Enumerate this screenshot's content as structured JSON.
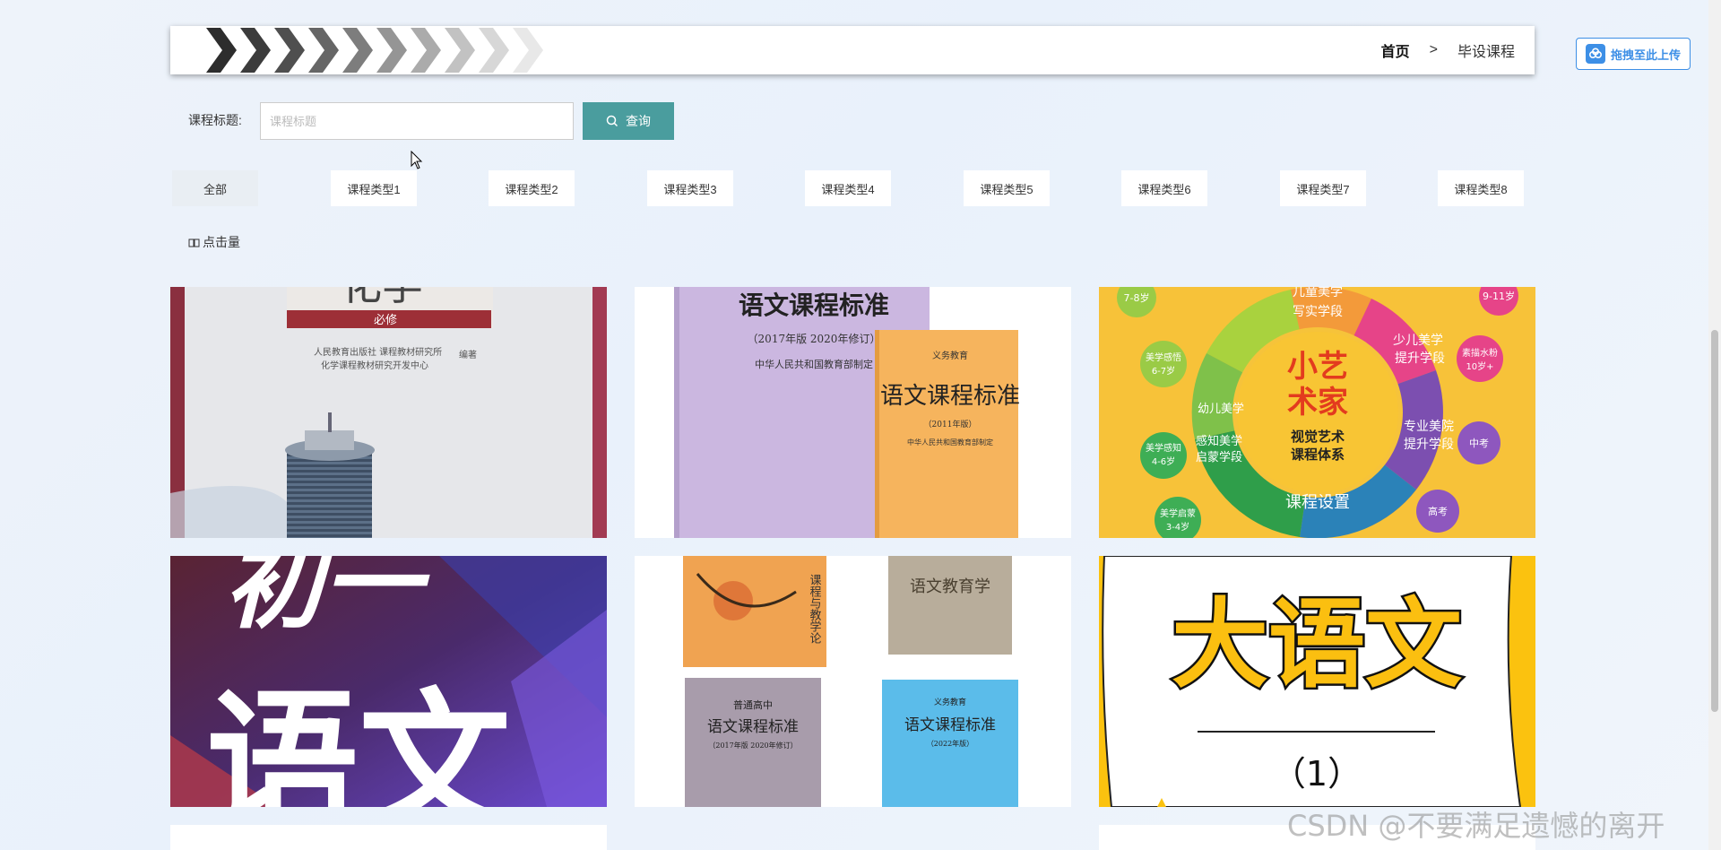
{
  "header": {
    "breadcrumb_home": "首页",
    "breadcrumb_sep": ">",
    "breadcrumb_current": "毕设课程"
  },
  "upload": {
    "label": "拖拽至此上传"
  },
  "search": {
    "label": "课程标题:",
    "placeholder": "课程标题",
    "button_label": "查询"
  },
  "categories": [
    "全部",
    "课程类型1",
    "课程类型2",
    "课程类型3",
    "课程类型4",
    "课程类型5",
    "课程类型6",
    "课程类型7",
    "课程类型8"
  ],
  "sort": {
    "label": "点击量"
  },
  "cards": [
    {
      "texts": [
        "化学",
        "必修",
        "人民教育出版社 课程教材研究所",
        "化学课程教材研究开发中心",
        "编著"
      ]
    },
    {
      "texts": [
        "语文课程标准",
        "（2017年版 2020年修订）",
        "中华人民共和国教育部制定",
        "义务教育",
        "语文课程标准",
        "（2011年版）",
        "中华人民共和国教育部制定"
      ]
    },
    {
      "texts": [
        "小艺",
        "术家",
        "视觉艺术",
        "课程体系",
        "课程设置",
        "儿童美学",
        "写实学段",
        "少儿美学",
        "提升学段",
        "专业美院",
        "提升学段",
        "感知美学",
        "启蒙学段",
        "幼儿美学",
        "7-8岁",
        "9-11岁",
        "美学感悟",
        "6-7岁",
        "素描水粉",
        "10岁+",
        "美学感知",
        "4-6岁",
        "中考",
        "美学启蒙",
        "3-4岁",
        "高考"
      ]
    },
    {
      "texts": [
        "初一",
        "语文"
      ]
    },
    {
      "texts": [
        "课程与教学论",
        "语文教育学",
        "普通高中",
        "语文课程标准",
        "（2017年版 2020年修订）",
        "义务教育",
        "语文课程标准",
        "（2022年版）"
      ]
    },
    {
      "texts": [
        "大语文",
        "（1）"
      ]
    }
  ],
  "watermark": "CSDN @不要满足遗憾的离开",
  "colors": {
    "accent": "#4a9d9e",
    "upload": "#3d8fe6"
  }
}
